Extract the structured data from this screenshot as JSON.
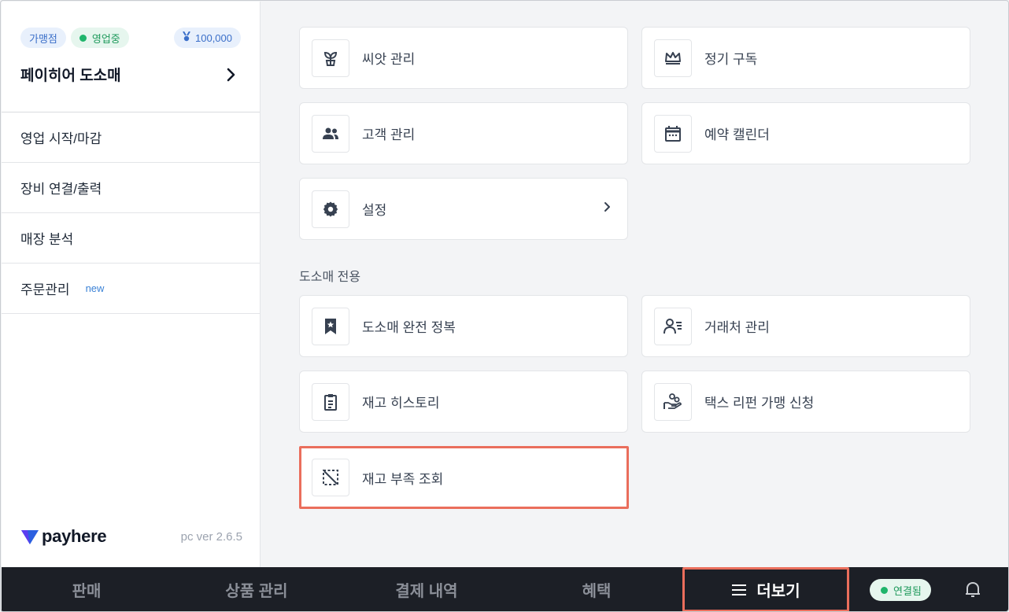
{
  "sidebar": {
    "badges": {
      "franchise": "가맹점",
      "status": "영업중",
      "points": "100,000"
    },
    "store_name": "페이히어 도소매",
    "menu": [
      {
        "label": "영업 시작/마감"
      },
      {
        "label": "장비 연결/출력"
      },
      {
        "label": "매장 분석"
      },
      {
        "label": "주문관리",
        "tag": "new"
      }
    ],
    "logo_text": "payhere",
    "version": "pc ver 2.6.5"
  },
  "main": {
    "cards": [
      {
        "label": "씨앗 관리",
        "icon": "sprout-icon"
      },
      {
        "label": "정기 구독",
        "icon": "crown-icon"
      },
      {
        "label": "고객 관리",
        "icon": "people-icon"
      },
      {
        "label": "예약 캘린더",
        "icon": "calendar-icon"
      },
      {
        "label": "설정",
        "icon": "gear-icon"
      }
    ],
    "section_title": "도소매 전용",
    "wholesale_cards": [
      {
        "label": "도소매 완전 정복",
        "icon": "bookmark-star-icon"
      },
      {
        "label": "거래처 관리",
        "icon": "contact-list-icon"
      },
      {
        "label": "재고 히스토리",
        "icon": "clipboard-icon"
      },
      {
        "label": "택스 리펀 가맹 신청",
        "icon": "hand-coins-icon"
      },
      {
        "label": "재고 부족 조회",
        "icon": "dashed-slash-icon"
      }
    ]
  },
  "bottombar": {
    "tabs": [
      {
        "label": "판매"
      },
      {
        "label": "상품 관리"
      },
      {
        "label": "결제 내역"
      },
      {
        "label": "혜택"
      },
      {
        "label": "더보기",
        "active": true
      }
    ],
    "connection": "연결됨"
  },
  "colors": {
    "highlight": "#ea6e5c",
    "bottombar_bg": "#1c1f26",
    "success": "#1fb56b",
    "accent_blue": "#3b6fc9"
  }
}
